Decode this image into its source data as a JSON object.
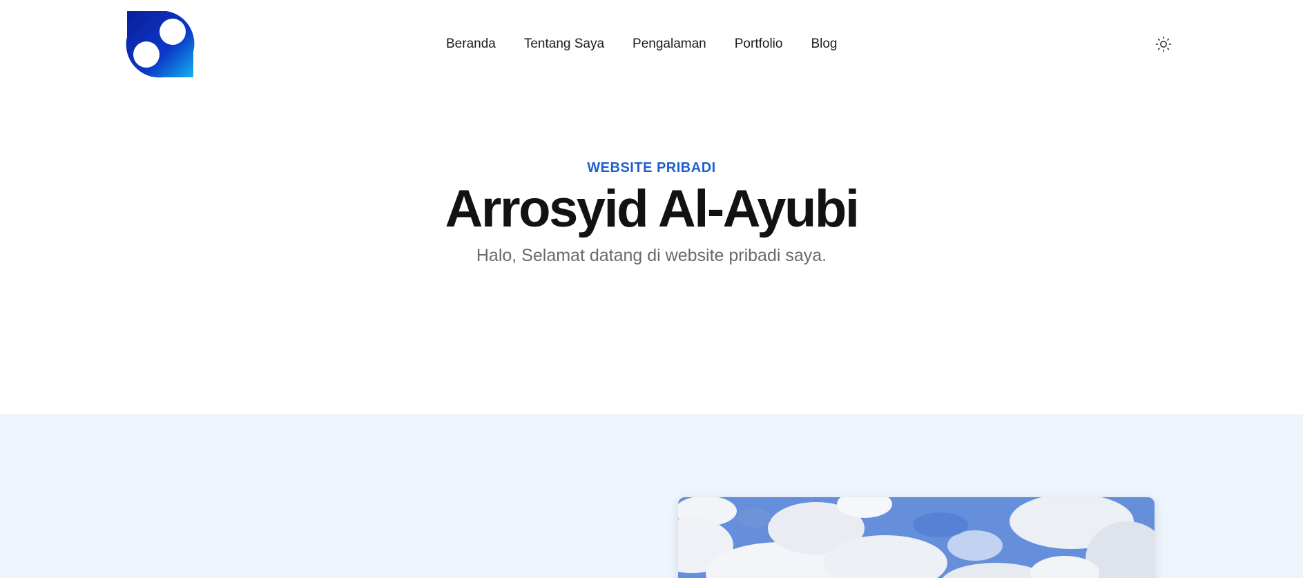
{
  "header": {
    "logo_icon": "brand-logo-icon",
    "nav": [
      {
        "label": "Beranda"
      },
      {
        "label": "Tentang Saya"
      },
      {
        "label": "Pengalaman"
      },
      {
        "label": "Portfolio"
      },
      {
        "label": "Blog"
      }
    ],
    "theme_toggle_icon": "sun-icon"
  },
  "hero": {
    "eyebrow": "WEBSITE PRIBADI",
    "title": "Arrosyid Al-Ayubi",
    "subtitle": "Halo, Selamat datang di website pribadi saya."
  },
  "colors": {
    "accent": "#1f5fcc",
    "logo_dark": "#0a2a9e",
    "logo_light": "#12a6e8",
    "section_bg": "#eef4fc",
    "sky": "#5b86d8"
  },
  "about": {
    "photo_icon": "sky-clouds-photo"
  }
}
